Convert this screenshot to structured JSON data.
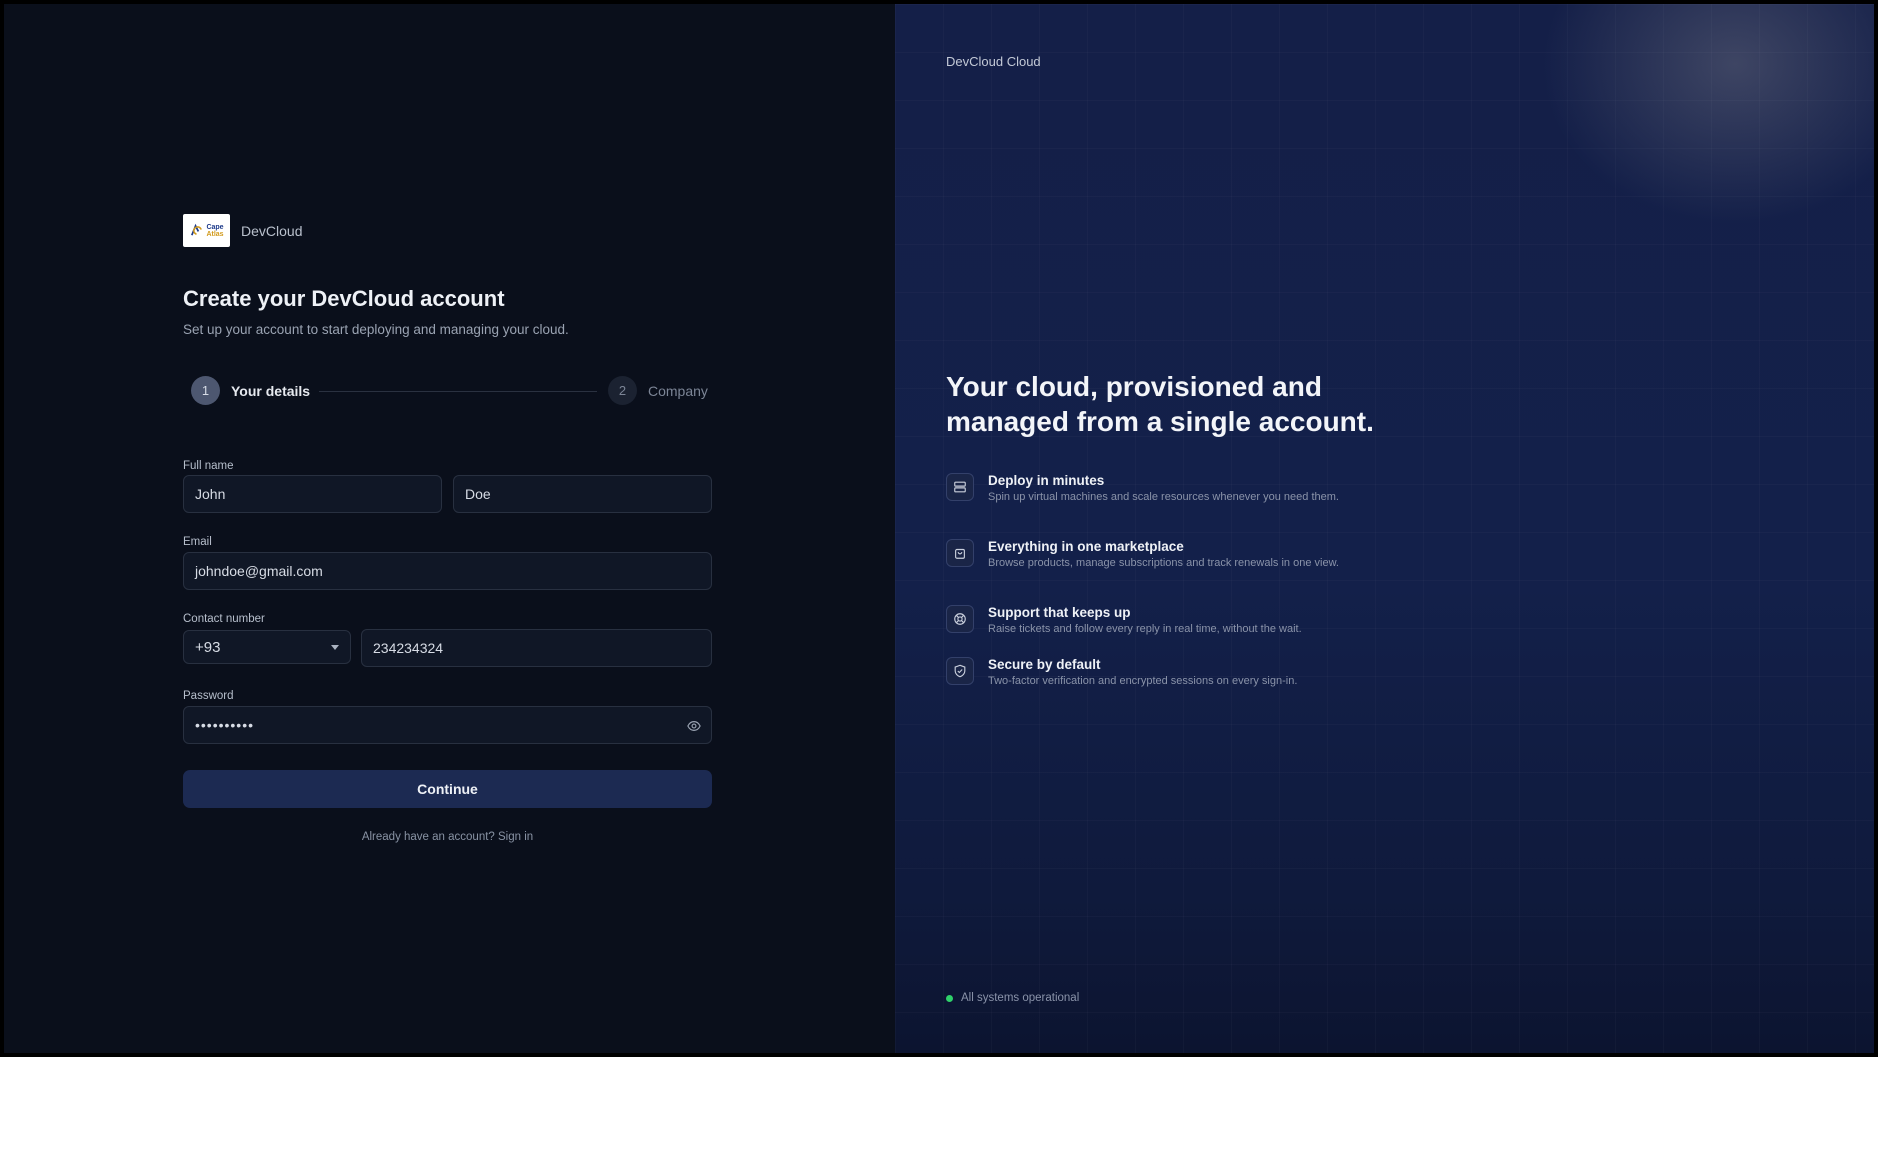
{
  "brand": {
    "name": "DevCloud",
    "logo_text_top": "Cape",
    "logo_text_bottom": "Atlas"
  },
  "form": {
    "title": "Create your DevCloud account",
    "subtitle": "Set up your account to start deploying and managing your cloud.",
    "steps": [
      {
        "number": "1",
        "label": "Your details",
        "active": true
      },
      {
        "number": "2",
        "label": "Company",
        "active": false
      }
    ],
    "full_name_label": "Full name",
    "first_name_value": "John",
    "last_name_value": "Doe",
    "email_label": "Email",
    "email_value": "johndoe@gmail.com",
    "contact_label": "Contact number",
    "country_code": "+93",
    "phone_value": "234234324",
    "password_label": "Password",
    "password_mask": "••••••••••",
    "continue_label": "Continue",
    "signin_text": "Already have an account? Sign in"
  },
  "hero": {
    "brand": "DevCloud Cloud",
    "headline": "Your cloud, provisioned and managed from a single account.",
    "features": [
      {
        "icon": "server-icon",
        "title": "Deploy in minutes",
        "desc": "Spin up virtual machines and scale resources whenever you need them."
      },
      {
        "icon": "bag-icon",
        "title": "Everything in one marketplace",
        "desc": "Browse products, manage subscriptions and track renewals in one view."
      },
      {
        "icon": "lifebuoy-icon",
        "title": "Support that keeps up",
        "desc": "Raise tickets and follow every reply in real time, without the wait."
      },
      {
        "icon": "shield-check-icon",
        "title": "Secure by default",
        "desc": "Two-factor verification and encrypted sessions on every sign-in."
      }
    ],
    "status": "All systems operational"
  },
  "colors": {
    "accent_button": "#1c2a52",
    "status_ok": "#2fd16a",
    "panel_left": "#0a0f1b",
    "panel_right": "#13204a"
  }
}
